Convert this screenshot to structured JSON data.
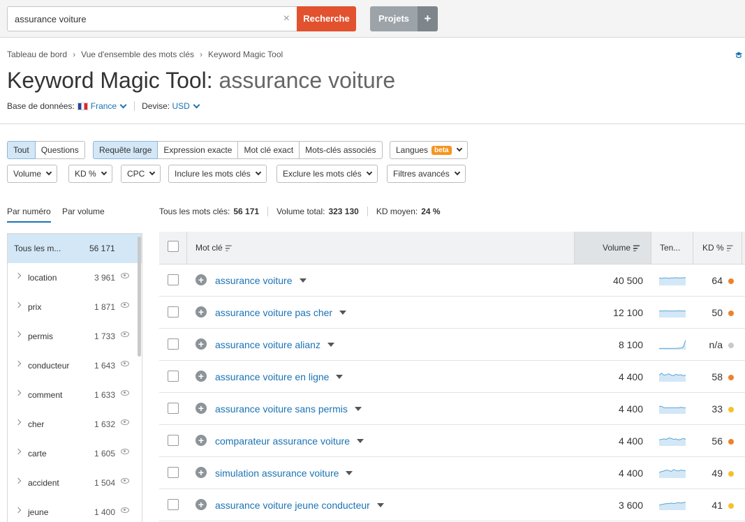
{
  "search": {
    "value": "assurance voiture",
    "clear_label": "×",
    "button": "Recherche"
  },
  "projects": {
    "label": "Projets",
    "plus": "+"
  },
  "breadcrumb": [
    "Tableau de bord",
    "Vue d'ensemble des mots clés",
    "Keyword Magic Tool"
  ],
  "breadcrumb_sep": "›",
  "title": {
    "prefix": "Keyword Magic Tool:",
    "keyword": "assurance voiture"
  },
  "database": {
    "label": "Base de données:",
    "value": "France",
    "currency_label": "Devise:",
    "currency": "USD"
  },
  "tabs_scope": [
    {
      "label": "Tout",
      "active": true
    },
    {
      "label": "Questions",
      "active": false
    }
  ],
  "tabs_match": [
    {
      "label": "Requête large",
      "active": true
    },
    {
      "label": "Expression exacte",
      "active": false
    },
    {
      "label": "Mot clé exact",
      "active": false
    },
    {
      "label": "Mots-clés associés",
      "active": false
    }
  ],
  "languages": {
    "label": "Langues",
    "badge": "beta"
  },
  "filters": [
    "Volume",
    "KD %",
    "CPC",
    "Inclure les mots clés",
    "Exclure les mots clés",
    "Filtres avancés"
  ],
  "group_tabs": {
    "by_number": "Par numéro",
    "by_volume": "Par volume"
  },
  "stats": {
    "all_label": "Tous les mots clés:",
    "all_value": "56 171",
    "volume_label": "Volume total:",
    "volume_value": "323 130",
    "kd_label": "KD moyen:",
    "kd_value": "24 %"
  },
  "groups_header": {
    "label": "Tous les m...",
    "count": "56 171"
  },
  "groups": [
    {
      "label": "location",
      "count": "3 961"
    },
    {
      "label": "prix",
      "count": "1 871"
    },
    {
      "label": "permis",
      "count": "1 733"
    },
    {
      "label": "conducteur",
      "count": "1 643"
    },
    {
      "label": "comment",
      "count": "1 633"
    },
    {
      "label": "cher",
      "count": "1 632"
    },
    {
      "label": "carte",
      "count": "1 605"
    },
    {
      "label": "accident",
      "count": "1 504"
    },
    {
      "label": "jeune",
      "count": "1 400"
    }
  ],
  "table": {
    "col_keyword": "Mot clé",
    "col_volume": "Volume",
    "col_trend": "Ten...",
    "col_kd": "KD %",
    "rows": [
      {
        "keyword": "assurance voiture",
        "volume": "40 500",
        "kd": "64",
        "kd_color": "#f0812b",
        "trend": [
          0.7,
          0.65,
          0.7,
          0.7,
          0.65,
          0.7,
          0.7,
          0.72,
          0.7,
          0.7,
          0.7,
          0.75
        ]
      },
      {
        "keyword": "assurance voiture pas cher",
        "volume": "12 100",
        "kd": "50",
        "kd_color": "#f0812b",
        "trend": [
          0.6,
          0.6,
          0.6,
          0.62,
          0.6,
          0.6,
          0.6,
          0.6,
          0.62,
          0.6,
          0.6,
          0.6
        ]
      },
      {
        "keyword": "assurance voiture alianz",
        "volume": "8 100",
        "kd": "n/a",
        "kd_color": "#c9c9c9",
        "trend": [
          0.05,
          0.05,
          0.05,
          0.05,
          0.05,
          0.06,
          0.05,
          0.06,
          0.08,
          0.1,
          0.2,
          0.9
        ]
      },
      {
        "keyword": "assurance voiture en ligne",
        "volume": "4 400",
        "kd": "58",
        "kd_color": "#f0812b",
        "trend": [
          0.6,
          0.8,
          0.6,
          0.65,
          0.75,
          0.6,
          0.55,
          0.7,
          0.6,
          0.65,
          0.55,
          0.6
        ]
      },
      {
        "keyword": "assurance voiture sans permis",
        "volume": "4 400",
        "kd": "33",
        "kd_color": "#f5c12b",
        "trend": [
          0.7,
          0.7,
          0.55,
          0.55,
          0.55,
          0.55,
          0.55,
          0.55,
          0.55,
          0.6,
          0.55,
          0.55
        ]
      },
      {
        "keyword": "comparateur assurance voiture",
        "volume": "4 400",
        "kd": "56",
        "kd_color": "#f0812b",
        "trend": [
          0.55,
          0.6,
          0.65,
          0.6,
          0.75,
          0.7,
          0.6,
          0.65,
          0.55,
          0.6,
          0.7,
          0.6
        ]
      },
      {
        "keyword": "simulation assurance voiture",
        "volume": "4 400",
        "kd": "49",
        "kd_color": "#f5c12b",
        "trend": [
          0.5,
          0.6,
          0.65,
          0.75,
          0.7,
          0.6,
          0.8,
          0.7,
          0.65,
          0.75,
          0.7,
          0.7
        ]
      },
      {
        "keyword": "assurance voiture jeune conducteur",
        "volume": "3 600",
        "kd": "41",
        "kd_color": "#f5c12b",
        "trend": [
          0.45,
          0.5,
          0.55,
          0.6,
          0.6,
          0.65,
          0.6,
          0.65,
          0.7,
          0.65,
          0.7,
          0.75
        ]
      }
    ]
  },
  "colors": {
    "accent": "#1a73b5",
    "search_button": "#e2522f",
    "active_seg": "#d3e7f6"
  }
}
